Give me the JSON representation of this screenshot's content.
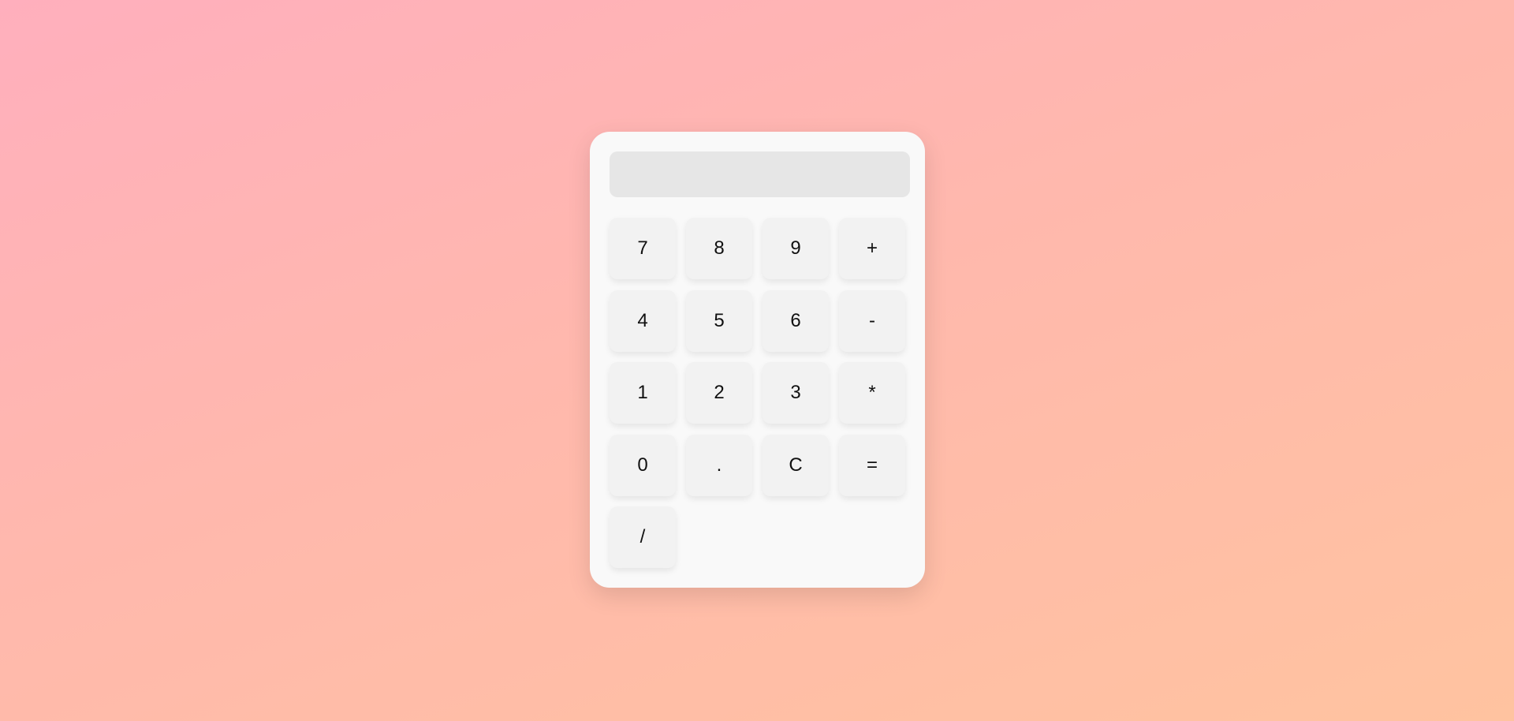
{
  "display": {
    "value": ""
  },
  "keys": [
    {
      "label": "7",
      "name": "key-7"
    },
    {
      "label": "8",
      "name": "key-8"
    },
    {
      "label": "9",
      "name": "key-9"
    },
    {
      "label": "+",
      "name": "key-plus"
    },
    {
      "label": "4",
      "name": "key-4"
    },
    {
      "label": "5",
      "name": "key-5"
    },
    {
      "label": "6",
      "name": "key-6"
    },
    {
      "label": "-",
      "name": "key-minus"
    },
    {
      "label": "1",
      "name": "key-1"
    },
    {
      "label": "2",
      "name": "key-2"
    },
    {
      "label": "3",
      "name": "key-3"
    },
    {
      "label": "*",
      "name": "key-multiply"
    },
    {
      "label": "0",
      "name": "key-0"
    },
    {
      "label": ".",
      "name": "key-decimal"
    },
    {
      "label": "C",
      "name": "key-clear"
    },
    {
      "label": "=",
      "name": "key-equals"
    },
    {
      "label": "/",
      "name": "key-divide"
    }
  ],
  "colors": {
    "background_start": "#ffafbd",
    "background_end": "#ffc3a0",
    "panel": "#f9f9f9",
    "display": "#e6e6e6",
    "key": "#f2f2f2"
  }
}
